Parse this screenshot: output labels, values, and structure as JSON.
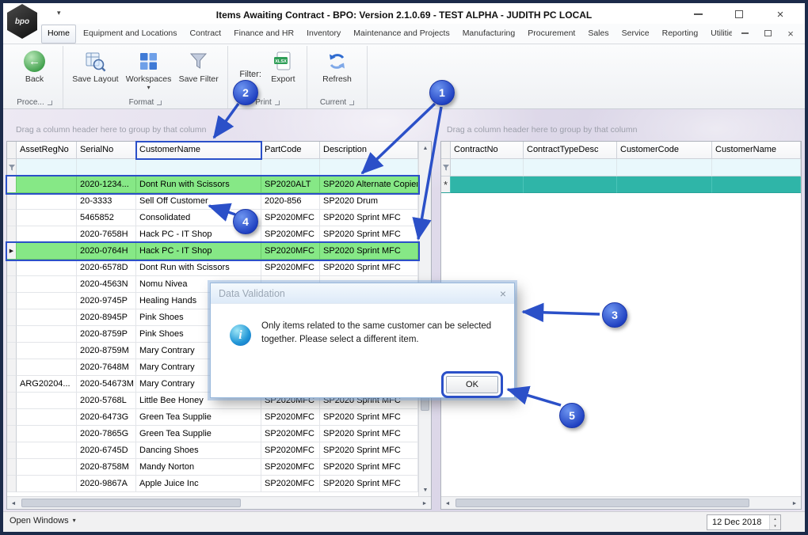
{
  "window": {
    "title": "Items Awaiting Contract - BPO: Version 2.1.0.69 - TEST ALPHA - JUDITH PC LOCAL",
    "logo_text": "bpo"
  },
  "menu": {
    "tabs": [
      "Home",
      "Equipment and Locations",
      "Contract",
      "Finance and HR",
      "Inventory",
      "Maintenance and Projects",
      "Manufacturing",
      "Procurement",
      "Sales",
      "Service",
      "Reporting",
      "Utilities"
    ],
    "active_tab": "Home"
  },
  "ribbon": {
    "buttons": {
      "back": "Back",
      "save_layout": "Save Layout",
      "workspaces": "Workspaces",
      "save_filter": "Save Filter",
      "filter_label": "Filter:",
      "export": "Export",
      "refresh": "Refresh"
    },
    "groups": [
      "Proce...",
      "Format",
      "Print",
      "Current"
    ]
  },
  "left_grid": {
    "group_hint": "Drag a column header here to group by that column",
    "columns": [
      "AssetRegNo",
      "SerialNo",
      "CustomerName",
      "PartCode",
      "Description"
    ],
    "rows": [
      {
        "asset": "",
        "serial": "2020-1234...",
        "customer": "Dont Run with Scissors",
        "part": "SP2020ALT",
        "desc": "SP2020 Alternate Copier",
        "selected": true
      },
      {
        "asset": "",
        "serial": "20-3333",
        "customer": "Sell Off Customer",
        "part": "2020-856",
        "desc": "SP2020 Drum"
      },
      {
        "asset": "",
        "serial": "5465852",
        "customer": "Consolidated",
        "part": "SP2020MFC",
        "desc": "SP2020 Sprint MFC"
      },
      {
        "asset": "",
        "serial": "2020-7658H",
        "customer": "Hack PC - IT Shop",
        "part": "SP2020MFC",
        "desc": "SP2020 Sprint MFC"
      },
      {
        "asset": "",
        "serial": "2020-0764H",
        "customer": "Hack PC - IT Shop",
        "part": "SP2020MFC",
        "desc": "SP2020 Sprint MFC",
        "selected": true,
        "current": true
      },
      {
        "asset": "",
        "serial": "2020-6578D",
        "customer": "Dont Run with Scissors",
        "part": "SP2020MFC",
        "desc": "SP2020 Sprint MFC"
      },
      {
        "asset": "",
        "serial": "2020-4563N",
        "customer": "Nomu Nivea",
        "part": "",
        "desc": ""
      },
      {
        "asset": "",
        "serial": "2020-9745P",
        "customer": "Healing Hands",
        "part": "",
        "desc": ""
      },
      {
        "asset": "",
        "serial": "2020-8945P",
        "customer": "Pink Shoes",
        "part": "",
        "desc": ""
      },
      {
        "asset": "",
        "serial": "2020-8759P",
        "customer": "Pink Shoes",
        "part": "",
        "desc": ""
      },
      {
        "asset": "",
        "serial": "2020-8759M",
        "customer": "Mary Contrary",
        "part": "",
        "desc": ""
      },
      {
        "asset": "",
        "serial": "2020-7648M",
        "customer": "Mary Contrary",
        "part": "",
        "desc": ""
      },
      {
        "asset": "ARG20204...",
        "serial": "2020-54673M",
        "customer": "Mary Contrary",
        "part": "",
        "desc": ""
      },
      {
        "asset": "",
        "serial": "2020-5768L",
        "customer": "Little Bee Honey",
        "part": "SP2020MFC",
        "desc": "SP2020 Sprint MFC"
      },
      {
        "asset": "",
        "serial": "2020-6473G",
        "customer": "Green Tea Supplie",
        "part": "SP2020MFC",
        "desc": "SP2020 Sprint MFC"
      },
      {
        "asset": "",
        "serial": "2020-7865G",
        "customer": "Green Tea Supplie",
        "part": "SP2020MFC",
        "desc": "SP2020 Sprint MFC"
      },
      {
        "asset": "",
        "serial": "2020-6745D",
        "customer": "Dancing Shoes",
        "part": "SP2020MFC",
        "desc": "SP2020 Sprint MFC"
      },
      {
        "asset": "",
        "serial": "2020-8758M",
        "customer": "Mandy Norton",
        "part": "SP2020MFC",
        "desc": "SP2020 Sprint MFC"
      },
      {
        "asset": "",
        "serial": "2020-9867A",
        "customer": "Apple Juice Inc",
        "part": "SP2020MFC",
        "desc": "SP2020 Sprint MFC"
      }
    ]
  },
  "right_grid": {
    "group_hint": "Drag a column header here to group by that column",
    "columns": [
      "ContractNo",
      "ContractTypeDesc",
      "CustomerCode",
      "CustomerName"
    ],
    "new_row_indicator": "*"
  },
  "dialog": {
    "title": "Data Validation",
    "message": "Only items related to the same customer can be selected together. Please select a different item.",
    "ok_label": "OK"
  },
  "callouts": [
    {
      "n": "1"
    },
    {
      "n": "2"
    },
    {
      "n": "3"
    },
    {
      "n": "4"
    },
    {
      "n": "5"
    }
  ],
  "statusbar": {
    "open_windows": "Open Windows",
    "date": "12 Dec 2018"
  },
  "icons": {
    "chevron_down": "▾",
    "chevron_up": "▴",
    "close": "×",
    "back_arrow": "←",
    "scroll_up": "▲",
    "scroll_down": "▼",
    "scroll_left": "◄",
    "scroll_right": "►",
    "current_row": "▶",
    "info": "i"
  },
  "colors": {
    "selected_row_green": "#86E886",
    "new_row_teal": "#2FB5A8",
    "callout_blue": "#2B50C8"
  }
}
